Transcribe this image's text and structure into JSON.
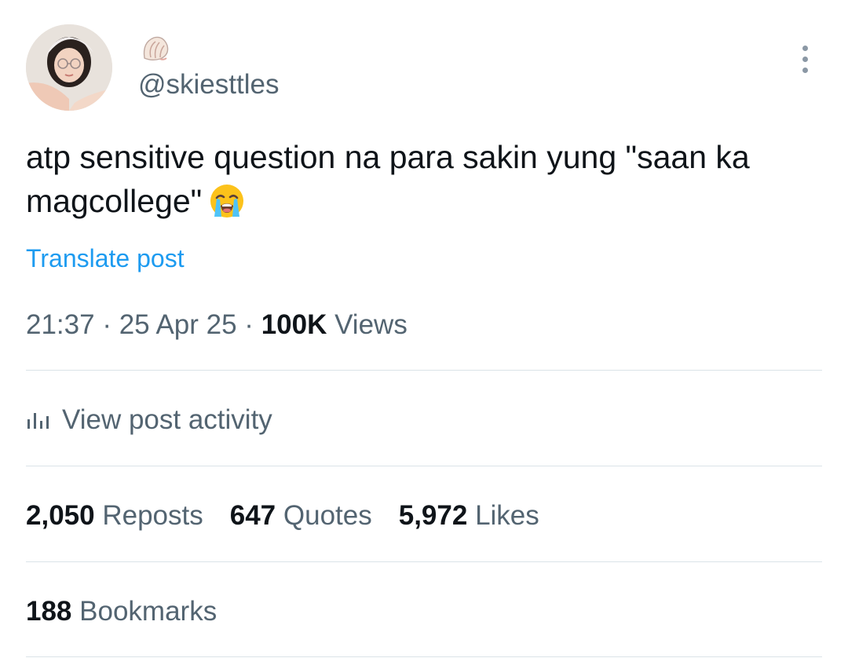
{
  "post": {
    "handle": "@skiesttles",
    "text": "atp sensitive question na para sakin yung \"saan ka magcollege\"",
    "translate_label": "Translate post",
    "time": "21:37",
    "date": "25 Apr 25",
    "views_count": "100K",
    "views_label": "Views",
    "activity_label": "View post activity",
    "reposts_count": "2,050",
    "reposts_label": "Reposts",
    "quotes_count": "647",
    "quotes_label": "Quotes",
    "likes_count": "5,972",
    "likes_label": "Likes",
    "bookmarks_count": "188",
    "bookmarks_label": "Bookmarks"
  },
  "icons": {
    "display_name": "shell-icon",
    "text_emoji": "loudly-crying-face-icon",
    "more": "more-vertical-icon",
    "activity": "analytics-bars-icon"
  },
  "colors": {
    "text": "#0f1419",
    "secondary": "#536471",
    "link": "#1d9bf0",
    "divider": "#dbe3e8"
  }
}
